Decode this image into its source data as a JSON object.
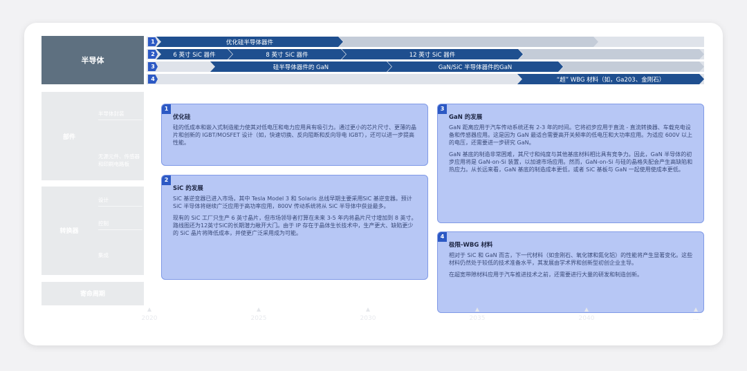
{
  "left_categories": {
    "main": "半导体",
    "components": {
      "label": "部件",
      "subs": [
        "半导体封装",
        "无源元件、传感器和印刷电路板"
      ]
    },
    "converter": {
      "label": "转换器",
      "subs": [
        "设计",
        "控制",
        "集成"
      ]
    },
    "thermal": {
      "label": "寄命周期"
    }
  },
  "timeline_rows": [
    {
      "num": "1",
      "segments": [
        "优化硅半导体器件"
      ]
    },
    {
      "num": "2",
      "segments": [
        "6 英寸 SiC 器件",
        "8 英寸 SiC 器件",
        "12 英寸 SiC 器件"
      ]
    },
    {
      "num": "3",
      "segments": [
        "硅半导体器件的 GaN",
        "GaN/SiC 半导体器件的GaN"
      ]
    },
    {
      "num": "4",
      "segments": [
        "“超” WBG 材料（如，Ga203、金刚石）"
      ]
    }
  ],
  "boxes": [
    {
      "num": "1",
      "title": "优化硅",
      "paragraphs": [
        "硅的低成本和嵌入式制造能力使其对低电压和电力应用具有吸引力。通过更小的芯片尺寸、更薄的晶片和创新的 IGBT/MOSFET 设计（如，快速切换、反向阻断和反向导电 IGBT），还可以进一步提高性能。"
      ]
    },
    {
      "num": "2",
      "title": "SiC 的发展",
      "paragraphs": [
        "SiC 基逆变器已进入市场，其中 Tesla Model 3 和 Solaris 总线早期主要采用SiC 基逆变器。预计 SiC 半导体将继续广泛应用于高功率应用，800V 传动系统将从 SiC 半导体中获益最多。",
        "现有的 SiC 工厂只生产 6 英寸晶片，但市场领导者打算在未来 3-5 年内将晶片尺寸增加到 8 英寸。路线图还为12英寸SiC的长期潜力敞开大门。由于 IP 存在于晶体生长技术中，生产更大、缺陷更少的 SiC 晶片将降低成本，并使更广泛采用成为可能。"
      ]
    },
    {
      "num": "3",
      "title": "GaN 的发展",
      "paragraphs": [
        "GaN 距离应用于汽车传动系统还有 2-3 年的时间。它将初步应用于直流 - 直流转换器、车载充电设备和传感器应用。这是因为 GaN 最适合需要高开关频率的低电压和大功率应用。为适应 600V 以上的电压，还需要进一步研究 GaN。",
        "GaN 基底的制造非常困难，其尺寸和纯度与其他基底材料相比具有竞争力。因此，GaN 半导体的初步应用将是 GaN-on-Si 装置，以加速市场应用。然而，GaN-on-Si 与硅的晶格失配会产生高缺陷和热应力。从长远来看，GaN 基底的制造成本更低，或者 SiC 基板与 GaN 一起使用使成本更低。"
      ]
    },
    {
      "num": "4",
      "title": "极限-WBG 材料",
      "paragraphs": [
        "相对于 SiC 和 GaN 而言，下一代材料（如金刚石、氧化镓和氮化铝）的性能将产生显著变化。这些材料仍然处于较低的技术准备水平，其发展由学术界和创新型初创企业主导。",
        "在超宽带隙材料应用于汽车推进技术之前，还需要进行大量的研发和制造创新。"
      ]
    }
  ],
  "axis_years": [
    "2020",
    "2025",
    "2030",
    "2035",
    "2040",
    "..."
  ],
  "colors": {
    "dark_chevron": "#1f4f8f",
    "box_fill": "#b7c7f5",
    "badge": "#2c59c4",
    "category": "#5e7080"
  }
}
